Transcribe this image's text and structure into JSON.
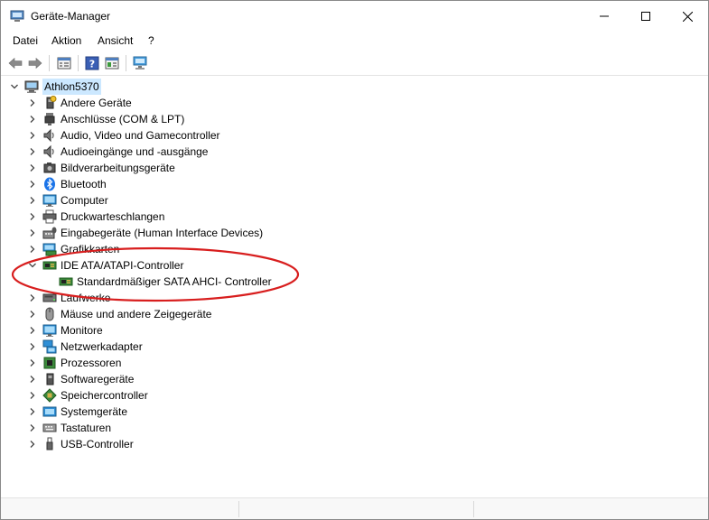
{
  "window": {
    "title": "Geräte-Manager",
    "app_icon": "device-manager-icon",
    "controls": {
      "minimize_icon": "minimize-icon",
      "maximize_icon": "maximize-icon",
      "close_icon": "close-icon"
    }
  },
  "menu": [
    "Datei",
    "Aktion",
    "Ansicht",
    "?"
  ],
  "toolbar": {
    "buttons": [
      "back-arrow-icon",
      "forward-arrow-icon",
      "properties-icon",
      "help-icon",
      "update-driver-icon",
      "scan-hardware-icon"
    ]
  },
  "tree": {
    "root": {
      "label": "Athlon5370",
      "icon": "computer-icon",
      "expanded": true,
      "selected": true
    },
    "items": [
      {
        "label": "Andere Geräte",
        "icon": "unknown-device-icon",
        "expanded": false
      },
      {
        "label": "Anschlüsse (COM & LPT)",
        "icon": "port-icon",
        "expanded": false
      },
      {
        "label": "Audio, Video und Gamecontroller",
        "icon": "speaker-icon",
        "expanded": false
      },
      {
        "label": "Audioeingänge und -ausgänge",
        "icon": "speaker-icon",
        "expanded": false
      },
      {
        "label": "Bildverarbeitungsgeräte",
        "icon": "camera-icon",
        "expanded": false
      },
      {
        "label": "Bluetooth",
        "icon": "bluetooth-icon",
        "expanded": false
      },
      {
        "label": "Computer",
        "icon": "monitor-icon",
        "expanded": false
      },
      {
        "label": "Druckwarteschlangen",
        "icon": "printer-icon",
        "expanded": false
      },
      {
        "label": "Eingabegeräte (Human Interface Devices)",
        "icon": "hid-icon",
        "expanded": false
      },
      {
        "label": "Grafikkarten",
        "icon": "display-adapter-icon",
        "expanded": false
      },
      {
        "label": "IDE ATA/ATAPI-Controller",
        "icon": "controller-icon",
        "expanded": true,
        "children": [
          {
            "label": "Standardmäßiger SATA AHCI- Controller",
            "icon": "controller-icon"
          }
        ]
      },
      {
        "label": "Laufwerke",
        "icon": "disk-drive-icon",
        "expanded": false
      },
      {
        "label": "Mäuse und andere Zeigegeräte",
        "icon": "mouse-icon",
        "expanded": false
      },
      {
        "label": "Monitore",
        "icon": "monitor-icon",
        "expanded": false
      },
      {
        "label": "Netzwerkadapter",
        "icon": "network-adapter-icon",
        "expanded": false
      },
      {
        "label": "Prozessoren",
        "icon": "processor-icon",
        "expanded": false
      },
      {
        "label": "Softwaregeräte",
        "icon": "software-device-icon",
        "expanded": false
      },
      {
        "label": "Speichercontroller",
        "icon": "storage-controller-icon",
        "expanded": false
      },
      {
        "label": "Systemgeräte",
        "icon": "system-device-icon",
        "expanded": false
      },
      {
        "label": "Tastaturen",
        "icon": "keyboard-icon",
        "expanded": false
      },
      {
        "label": "USB-Controller",
        "icon": "usb-icon",
        "expanded": false
      }
    ]
  },
  "annotation": {
    "shape": "ellipse",
    "color": "#d81e1e"
  },
  "colors": {
    "selection": "#cce8ff",
    "accent": "#0078d7"
  }
}
